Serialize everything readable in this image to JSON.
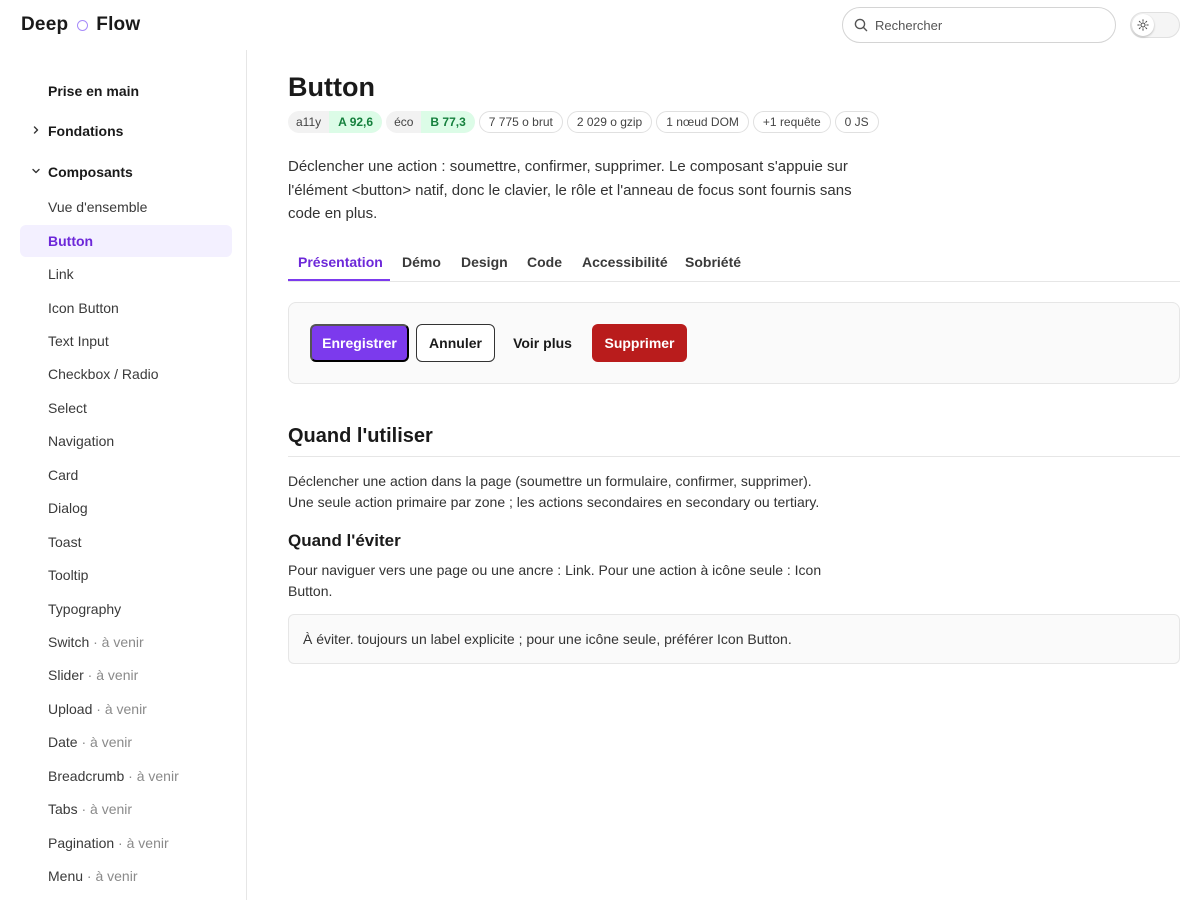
{
  "brand": {
    "part1": "Deep",
    "part2": "Flow"
  },
  "search": {
    "placeholder": "Rechercher",
    "value": ""
  },
  "theme_toggle": {
    "icon": "sun-icon"
  },
  "colors": {
    "accent": "#7c3aed",
    "danger": "#b91c1c",
    "success_bg": "#dcfce7",
    "success_text": "#15803d"
  },
  "sidebar": {
    "groups": {
      "start": "Prise en main",
      "foundations": "Fondations",
      "components": "Composants"
    },
    "items": [
      {
        "label": "Vue d'ensemble",
        "soon": ""
      },
      {
        "label": "Button",
        "soon": ""
      },
      {
        "label": "Link",
        "soon": ""
      },
      {
        "label": "Icon Button",
        "soon": ""
      },
      {
        "label": "Text Input",
        "soon": ""
      },
      {
        "label": "Checkbox / Radio",
        "soon": ""
      },
      {
        "label": "Select",
        "soon": ""
      },
      {
        "label": "Navigation",
        "soon": ""
      },
      {
        "label": "Card",
        "soon": ""
      },
      {
        "label": "Dialog",
        "soon": ""
      },
      {
        "label": "Toast",
        "soon": ""
      },
      {
        "label": "Tooltip",
        "soon": ""
      },
      {
        "label": "Typography",
        "soon": ""
      },
      {
        "label": "Switch",
        "soon": " · à venir"
      },
      {
        "label": "Slider",
        "soon": " · à venir"
      },
      {
        "label": "Upload",
        "soon": " · à venir"
      },
      {
        "label": "Date",
        "soon": " · à venir"
      },
      {
        "label": "Breadcrumb",
        "soon": " · à venir"
      },
      {
        "label": "Tabs",
        "soon": " · à venir"
      },
      {
        "label": "Pagination",
        "soon": " · à venir"
      },
      {
        "label": "Menu",
        "soon": " · à venir"
      }
    ]
  },
  "page": {
    "title": "Button",
    "badges": {
      "a11y_key": "a11y",
      "a11y_value": "A 92,6",
      "eco_key": "éco",
      "eco_value": "B 77,3",
      "raw": "7 775 o brut",
      "gzip": "2 029 o gzip",
      "dom": "1 nœud DOM",
      "request": "+1 requête",
      "js": "0 JS"
    },
    "intro": "Déclencher une action : soumettre, confirmer, supprimer. Le composant s'appuie sur l'élément <button> natif, donc le clavier, le rôle et l'anneau de focus sont fournis sans code en plus.",
    "tabs": [
      "Présentation",
      "Démo",
      "Design",
      "Code",
      "Accessibilité",
      "Sobriété"
    ],
    "demo": {
      "primary": "Enregistrer",
      "secondary": "Annuler",
      "tertiary": "Voir plus",
      "danger": "Supprimer"
    },
    "when_title": "Quand l'utiliser",
    "when_line1": "Déclencher une action dans la page (soumettre un formulaire, confirmer, supprimer).",
    "when_line2": "Une seule action primaire par zone ; les actions secondaires en secondary ou tertiary.",
    "avoid_title": "Quand l'éviter",
    "avoid_text": "Pour naviguer vers une page ou une ancre : Link. Pour une action à icône seule : Icon Button.",
    "note": "À éviter. toujours un label explicite ; pour une icône seule, préférer Icon Button."
  }
}
